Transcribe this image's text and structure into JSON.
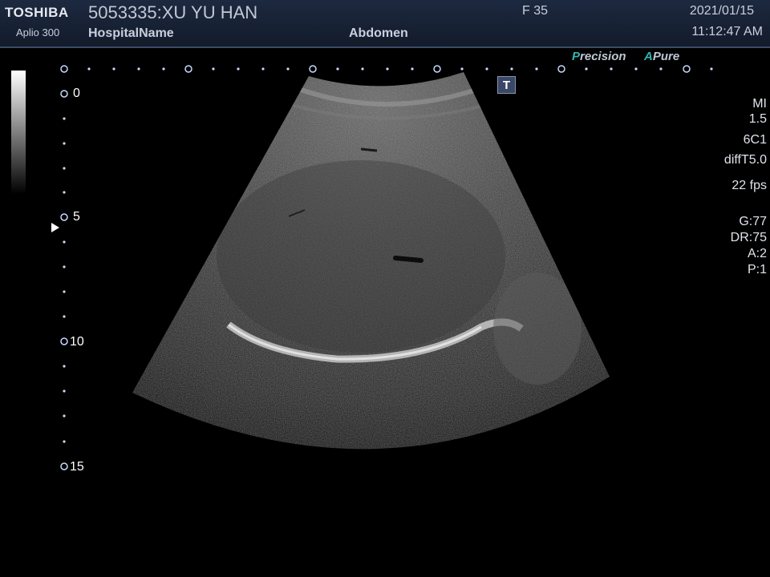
{
  "header": {
    "brand": "TOSHIBA",
    "model": "Aplio 300",
    "patient": "5053335:XU YU HAN",
    "hospital": "HospitalName",
    "region": "Abdomen",
    "frame": "F  35",
    "date": "2021/01/15",
    "time": "11:12:47 AM"
  },
  "modes": {
    "precision_lead": "P",
    "precision_rest": "recision",
    "apure_lead": "A",
    "apure_rest": "Pure"
  },
  "depth_scale": [
    "0",
    "5",
    "10",
    "15"
  ],
  "params": {
    "mi_label": "MI",
    "mi_value": "1.5",
    "probe": "6C1",
    "mode": "diffT5.0",
    "fps": "22 fps",
    "gain": "G:77",
    "dr": "DR:75",
    "a": "A:2",
    "p": "P:1"
  },
  "t_icon": "T"
}
